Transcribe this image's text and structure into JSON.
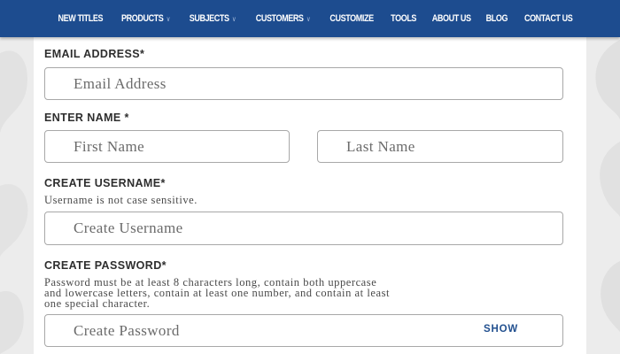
{
  "nav": {
    "items": [
      {
        "label": "NEW TITLES",
        "has_dropdown": false
      },
      {
        "label": "PRODUCTS",
        "has_dropdown": true
      },
      {
        "label": "SUBJECTS",
        "has_dropdown": true
      },
      {
        "label": "CUSTOMERS",
        "has_dropdown": true
      },
      {
        "label": "CUSTOMIZE",
        "has_dropdown": false
      },
      {
        "label": "TOOLS",
        "has_dropdown": false
      },
      {
        "label": "ABOUT US",
        "has_dropdown": false
      },
      {
        "label": "BLOG",
        "has_dropdown": false
      },
      {
        "label": "CONTACT US",
        "has_dropdown": false
      }
    ],
    "caret": "∨"
  },
  "form": {
    "email": {
      "label": "EMAIL ADDRESS*",
      "placeholder": "Email Address",
      "value": ""
    },
    "name": {
      "label": "ENTER NAME *",
      "first_placeholder": "First Name",
      "last_placeholder": "Last Name"
    },
    "username": {
      "label": "CREATE USERNAME*",
      "hint": "Username is not case sensitive.",
      "placeholder": "Create Username"
    },
    "password": {
      "label": "CREATE PASSWORD*",
      "hint_lines": [
        "Password must be at least 8 characters long, contain both uppercase",
        "and lowercase letters, contain at least one number, and contain at least",
        "one special character."
      ],
      "placeholder": "Create Password",
      "show_label": "SHOW"
    }
  },
  "colors": {
    "nav_background": "#1d4c8f",
    "page_background": "#ececec",
    "show_button": "#22508f"
  }
}
